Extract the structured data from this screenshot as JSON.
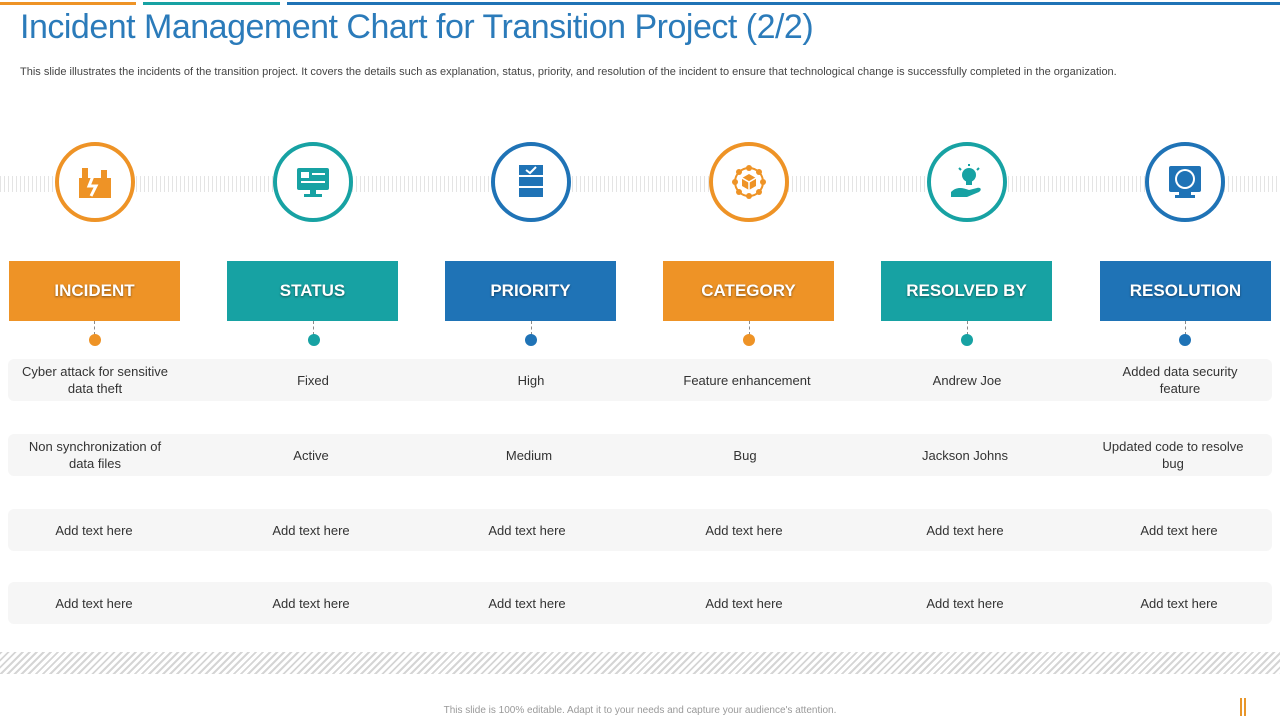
{
  "title": "Incident Management Chart for Transition Project (2/2)",
  "subtitle": "This slide illustrates the incidents of the transition project. It covers the details such as explanation, status, priority, and resolution of the incident to ensure that technological change is successfully completed in the organization.",
  "colors": {
    "orange": "#ee9326",
    "teal": "#17a2a3",
    "blue": "#1f73b6",
    "title_blue": "#2b7bba"
  },
  "columns": [
    {
      "label": "INCIDENT",
      "icon": "factory-damage-icon",
      "color": "#ee9326"
    },
    {
      "label": "STATUS",
      "icon": "monitor-icon",
      "color": "#17a2a3"
    },
    {
      "label": "PRIORITY",
      "icon": "checklist-icon",
      "color": "#1f73b6"
    },
    {
      "label": "CATEGORY",
      "icon": "network-box-icon",
      "color": "#ee9326"
    },
    {
      "label": "RESOLVED BY",
      "icon": "idea-hand-icon",
      "color": "#17a2a3"
    },
    {
      "label": "RESOLUTION",
      "icon": "screen-globe-icon",
      "color": "#1f73b6"
    }
  ],
  "rows": [
    [
      "Cyber attack for sensitive data theft",
      "Fixed",
      "High",
      "Feature enhancement",
      "Andrew Joe",
      "Added data security feature"
    ],
    [
      "Non synchronization of data files",
      "Active",
      "Medium",
      "Bug",
      "Jackson Johns",
      "Updated code to resolve bug"
    ],
    [
      "Add text here",
      "Add text here",
      "Add text here",
      "Add text here",
      "Add text here",
      "Add text here"
    ],
    [
      "Add text here",
      "Add text here",
      "Add text here",
      "Add text here",
      "Add text here",
      "Add text here"
    ]
  ],
  "footer": "This slide is 100% editable. Adapt it to your needs and capture your audience's attention."
}
